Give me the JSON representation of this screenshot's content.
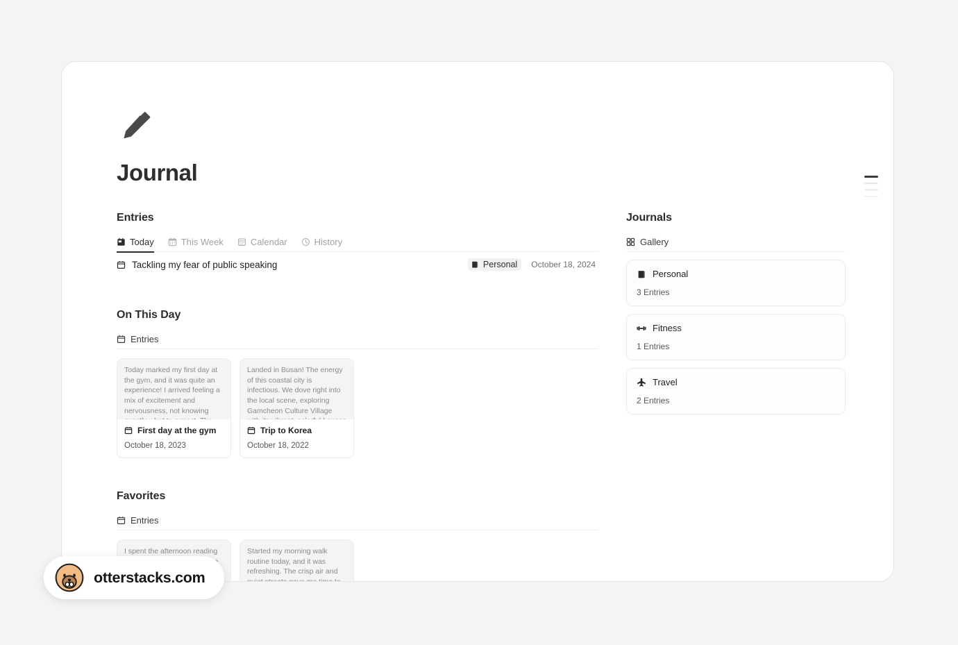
{
  "document": {
    "icon": "pencil-icon",
    "title": "Journal"
  },
  "outline_indicator": {
    "name": "outline-indicator"
  },
  "entries_section": {
    "title": "Entries",
    "tabs": [
      {
        "label": "Today",
        "icon": "calendar-filled-icon",
        "active": true
      },
      {
        "label": "This Week",
        "icon": "calendar-days-icon",
        "active": false
      },
      {
        "label": "Calendar",
        "icon": "calendar-grid-icon",
        "active": false
      },
      {
        "label": "History",
        "icon": "clock-icon",
        "active": false
      }
    ],
    "rows": [
      {
        "icon": "calendar-icon",
        "title": "Tackling my fear of public speaking",
        "journal": "Personal",
        "journal_icon": "book-icon",
        "date": "October 18, 2024"
      }
    ]
  },
  "on_this_day_section": {
    "title": "On This Day",
    "subhead": {
      "label": "Entries",
      "icon": "calendar-icon"
    },
    "cards": [
      {
        "preview": "Today marked my first day at the gym, and it was quite an experience! I arrived feeling a mix of excitement and nervousness, not knowing exactly what to expect. The",
        "name": "First day at the gym",
        "icon": "calendar-icon",
        "date": "October 18, 2023"
      },
      {
        "preview": "Landed in Busan! The energy of this coastal city is infectious. We dove right into the local scene, exploring Gamcheon Culture Village with its vibrant, colorful houses cascading down",
        "name": "Trip to Korea",
        "icon": "calendar-icon",
        "date": "October 18, 2022"
      }
    ]
  },
  "favorites_section": {
    "title": "Favorites",
    "subhead": {
      "label": "Entries",
      "icon": "calendar-icon"
    },
    "cards": [
      {
        "preview": "I spent the afternoon reading a book that has grown on me lately, the"
      },
      {
        "preview": "Started my morning walk routine today, and it was refreshing. The crisp air and quiet streets gave me time to clear my"
      }
    ]
  },
  "journals_section": {
    "title": "Journals",
    "subhead": {
      "label": "Gallery",
      "icon": "gallery-grid-icon"
    },
    "cards": [
      {
        "name": "Personal",
        "icon": "book-icon",
        "count": "3 Entries"
      },
      {
        "name": "Fitness",
        "icon": "dumbbell-icon",
        "count": "1 Entries"
      },
      {
        "name": "Travel",
        "icon": "airplane-icon",
        "count": "2 Entries"
      }
    ]
  },
  "watermark": {
    "text": "otterstacks.com",
    "icon": "otter-avatar-icon"
  }
}
